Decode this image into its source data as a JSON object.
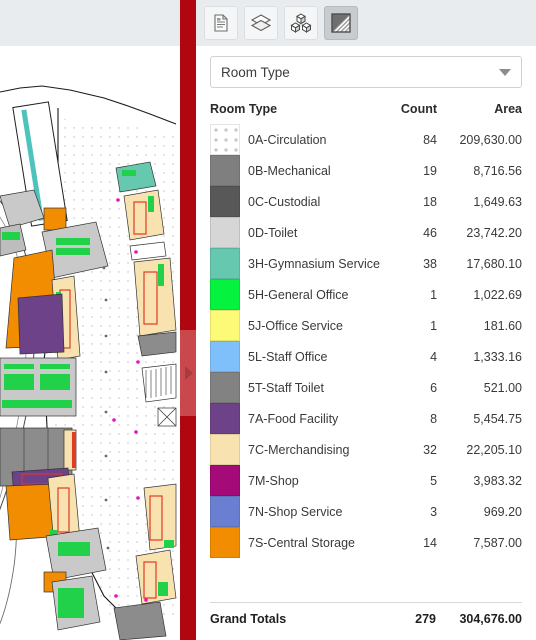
{
  "toolbar": {
    "buttons": [
      {
        "name": "report-icon",
        "label": "Report",
        "active": false
      },
      {
        "name": "layers-icon",
        "label": "Layers",
        "active": false
      },
      {
        "name": "blocks-icon",
        "label": "Blocks",
        "active": false
      },
      {
        "name": "legend-icon",
        "label": "Color Legend",
        "active": true
      }
    ]
  },
  "dropdown": {
    "selected": "Room Type",
    "options": [
      "Room Type"
    ]
  },
  "table": {
    "headers": {
      "name": "Room Type",
      "count": "Count",
      "area": "Area"
    },
    "rows": [
      {
        "color": "pattern-dots",
        "label": "0A-Circulation",
        "count": "84",
        "area": "209,630.00"
      },
      {
        "color": "#7f7f7f",
        "label": "0B-Mechanical",
        "count": "19",
        "area": "8,716.56"
      },
      {
        "color": "#585858",
        "label": "0C-Custodial",
        "count": "18",
        "area": "1,649.63"
      },
      {
        "color": "#d6d6d6",
        "label": "0D-Toilet",
        "count": "46",
        "area": "23,742.20"
      },
      {
        "color": "#66c8ae",
        "label": "3H-Gymnasium Service",
        "count": "38",
        "area": "17,680.10"
      },
      {
        "color": "#05f23f",
        "label": "5H-General Office",
        "count": "1",
        "area": "1,022.69"
      },
      {
        "color": "#fdfa78",
        "label": "5J-Office Service",
        "count": "1",
        "area": "181.60"
      },
      {
        "color": "#7fc0fb",
        "label": "5L-Staff Office",
        "count": "4",
        "area": "1,333.16"
      },
      {
        "color": "#828282",
        "label": "5T-Staff Toilet",
        "count": "6",
        "area": "521.00"
      },
      {
        "color": "#6d4288",
        "label": "7A-Food Facility",
        "count": "8",
        "area": "5,454.75"
      },
      {
        "color": "#f8e2b0",
        "label": "7C-Merchandising",
        "count": "32",
        "area": "22,205.10"
      },
      {
        "color": "#a40a78",
        "label": "7M-Shop",
        "count": "5",
        "area": "3,983.32"
      },
      {
        "color": "#6a7fd2",
        "label": "7N-Shop Service",
        "count": "3",
        "area": "969.20"
      },
      {
        "color": "#f28c00",
        "label": "7S-Central Storage",
        "count": "14",
        "area": "7,587.00"
      }
    ]
  },
  "totals": {
    "label": "Grand Totals",
    "count": "279",
    "area": "304,676.00"
  },
  "splitter": {
    "bar_color": "#b00610",
    "handle_color": "#c8484c",
    "collapse_icon": "triangle-right-icon"
  },
  "map": {
    "name": "floor-plan-drawing",
    "background": "#ffffff",
    "top_band_color": "#e8ecef"
  }
}
